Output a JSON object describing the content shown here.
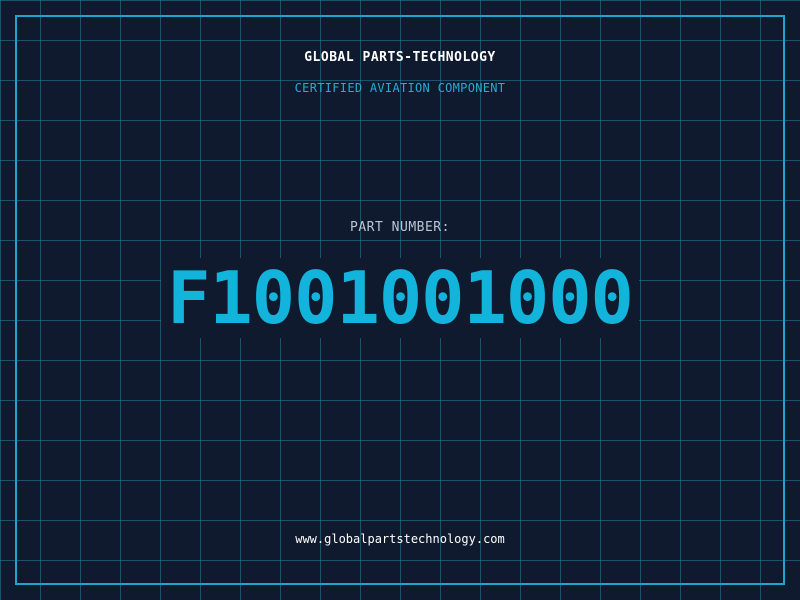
{
  "card": {
    "company_name": "GLOBAL PARTS-TECHNOLOGY",
    "tagline": "CERTIFIED AVIATION COMPONENT",
    "part_number_label": "PART NUMBER:",
    "part_number": "F1001001000",
    "website": "www.globalpartstechnology.com"
  },
  "colors": {
    "background": "#101a2e",
    "grid_line": "#2996b9",
    "frame_border": "#1fa3cf",
    "accent": "#12b4dc",
    "tagline": "#29a9d4",
    "label": "#b9c6d6",
    "text": "#ffffff"
  }
}
